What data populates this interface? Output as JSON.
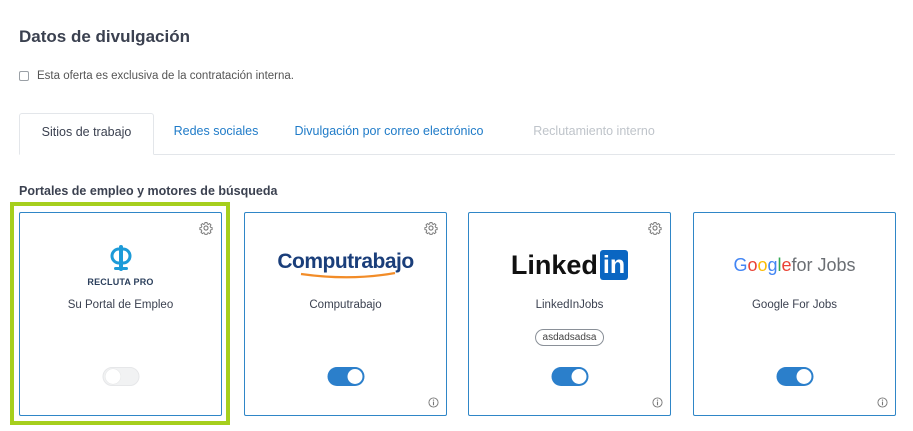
{
  "page": {
    "title": "Datos de divulgación",
    "exclusive_label": "Esta oferta es exclusiva de la contratación interna.",
    "section_label": "Portales de empleo y motores de búsqueda"
  },
  "tabs": [
    {
      "label": "Sitios de trabajo",
      "state": "active"
    },
    {
      "label": "Redes sociales",
      "state": "link"
    },
    {
      "label": "Divulgación por correo electrónico",
      "state": "link"
    },
    {
      "label": "Reclutamiento interno",
      "state": "disabled"
    }
  ],
  "cards": [
    {
      "name": "Su Portal de Empleo",
      "logo_text": "RECLUTA PRO",
      "enabled": false,
      "gear": true,
      "info": false
    },
    {
      "name": "Computrabajo",
      "logo_text": "Computrabajo",
      "enabled": true,
      "gear": true,
      "info": true
    },
    {
      "name": "LinkedInJobs",
      "logo_text": "Linked",
      "logo_box_text": "in",
      "tag": "asdadsadsa",
      "enabled": true,
      "gear": true,
      "info": true
    },
    {
      "name": "Google For Jobs",
      "logo_text": "Google",
      "logo_suffix": " for Jobs",
      "enabled": true,
      "gear": false,
      "info": true
    }
  ],
  "colors": {
    "accent": "#2b7fcb",
    "highlight": "#a6cf1d",
    "link": "#1f7bc8",
    "disabled": "#bfc4ca"
  },
  "icons": {
    "gear": "gear-icon",
    "info": "info-icon",
    "checkbox": "checkbox-icon"
  }
}
